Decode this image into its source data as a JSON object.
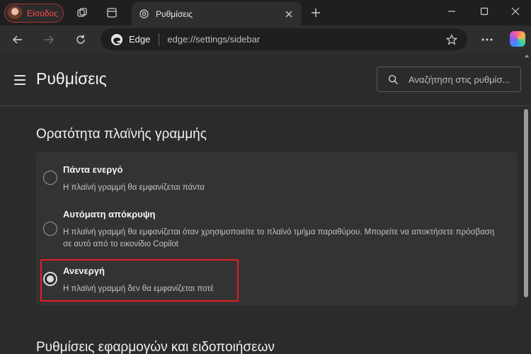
{
  "titlebar": {
    "profile_label": "Είσοδος",
    "tab_title": "Ρυθμίσεις"
  },
  "address_bar": {
    "browser_label": "Edge",
    "url": "edge://settings/sidebar"
  },
  "settings": {
    "page_title": "Ρυθμίσεις",
    "search_placeholder": "Αναζήτηση στις ρυθμίσ...",
    "section_title": "Ορατότητα πλαϊνής γραμμής",
    "options": [
      {
        "label": "Πάντα ενεργό",
        "desc": "Η πλαϊνή γραμμή θα εμφανίζεται πάντα",
        "selected": false
      },
      {
        "label": "Αυτόματη απόκρυψη",
        "desc": "Η πλαϊνή γραμμή θα εμφανίζεται όταν χρησιμοποιείτε το πλαϊνό τμήμα παραθύρου. Μπορείτε να αποκτήσετε πρόσβαση σε αυτό από το εικονίδιο Copilot",
        "selected": false
      },
      {
        "label": "Ανενεργή",
        "desc": "Η πλαϊνή γραμμή δεν θα εμφανίζεται ποτέ",
        "selected": true
      }
    ],
    "next_section_title": "Ρυθμίσεις εφαρμογών και ειδοποιήσεων"
  },
  "colors": {
    "highlight": "#e51c23",
    "profile_text": "#ff4a4a"
  }
}
